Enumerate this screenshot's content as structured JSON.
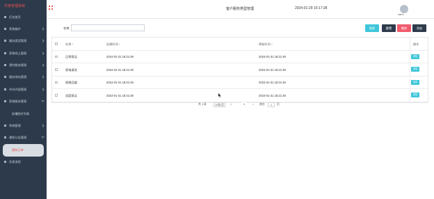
{
  "sidebar": {
    "brand": "乐家管理系统",
    "items": [
      {
        "label": "后台首页",
        "icon": "home-icon"
      },
      {
        "label": "系统维护",
        "icon": "settings-icon"
      },
      {
        "label": "服务类型管理",
        "icon": "list-icon"
      },
      {
        "label": "家政线上管理",
        "icon": "list-icon"
      },
      {
        "label": "预约服务管理",
        "icon": "calendar-icon"
      },
      {
        "label": "服务地址管理",
        "icon": "map-icon"
      },
      {
        "label": "评价内容管理",
        "icon": "comment-icon"
      },
      {
        "label": "家政服务管理",
        "icon": "service-icon"
      },
      {
        "label": "轮播图片列表",
        "icon": ""
      },
      {
        "label": "系统管理",
        "icon": "system-icon"
      },
      {
        "label": "通知公告管理",
        "icon": "bell-icon"
      },
      {
        "label": "通知订单",
        "icon": ""
      },
      {
        "label": "交易流程",
        "icon": "flow-icon"
      }
    ]
  },
  "topbar": {
    "title": "客户服务类型管理",
    "datetime": "2024-01-29 15:17:28",
    "username": "admin"
  },
  "search": {
    "label": "名称",
    "placeholder": "",
    "search_btn": "搜索",
    "reset_btn": "重置",
    "delete_btn": "删除",
    "add_btn": "添加"
  },
  "table": {
    "headers": [
      "名称 ↕",
      "创建时间 ↕",
      "更新时间 ↕",
      "操作"
    ],
    "rows": [
      {
        "name": "日常保洁",
        "created": "2024-01-31 18:21:49",
        "updated": "2024-01-31 18:21:49",
        "action": "详情"
      },
      {
        "name": "家电清洗",
        "created": "2024-01-31 18:21:49",
        "updated": "2024-01-31 18:21:49",
        "action": "详情"
      },
      {
        "name": "保姆月嫂",
        "created": "2024-01-31 18:21:49",
        "updated": "2024-01-31 18:21:49",
        "action": "详情"
      },
      {
        "name": "深度保洁",
        "created": "2024-01-31 18:21:49",
        "updated": "2024-01-31 18:21:49",
        "action": "详情"
      }
    ]
  },
  "pagination": {
    "total": "共 4 条",
    "page_size": "10条/页",
    "prev": "<",
    "current": "1",
    "next": ">",
    "goto": "前往",
    "goto_value": "1",
    "page_suffix": "页"
  },
  "colors": {
    "accent": "#3ec6d9",
    "danger": "#f15b6c",
    "sidebar": "#2d3a4b"
  }
}
